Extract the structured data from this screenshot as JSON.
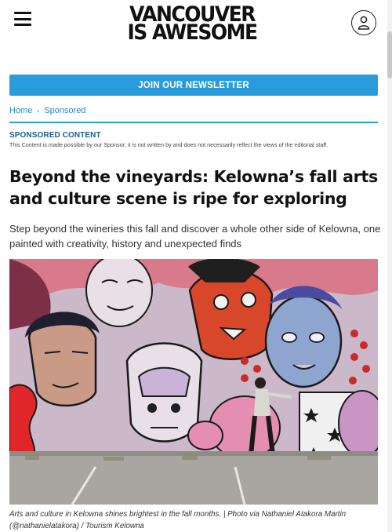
{
  "header": {
    "logo_line1": "VANCOUVER",
    "logo_line2": "IS AWESOME",
    "menu_icon": "hamburger-menu-icon",
    "account_icon": "user-account-icon"
  },
  "newsletter": {
    "label": "JOIN OUR NEWSLETTER"
  },
  "breadcrumb": {
    "home": "Home",
    "separator": "›",
    "section": "Sponsored"
  },
  "sponsored": {
    "heading": "SPONSORED CONTENT",
    "note": "This Content is made possible by our Sponsor; it is not written by and does not necessarily reflect the views of the editorial staff."
  },
  "article": {
    "headline": "Beyond the vineyards: Kelowna’s fall arts and culture scene is ripe for exploring",
    "dek": "Step beyond the wineries this fall and discover a whole other side of Kelowna, one painted with creativity, history and unexpected finds",
    "caption": "Arts and culture in Kelowna shines brightest in the fall months. | Photo via Nathaniel Atakora Martin (@nathanielatakora) / Tourism Kelowna"
  },
  "colors": {
    "accent": "#2a9bdb",
    "sponsored_heading": "#1d5d8f",
    "breadcrumb_link": "#2a86c8"
  }
}
